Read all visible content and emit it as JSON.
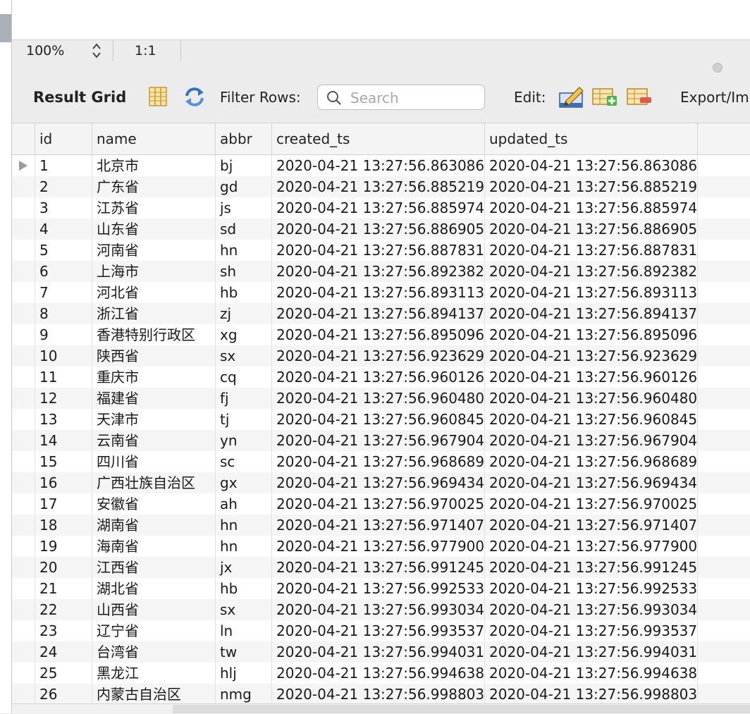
{
  "zoombar": {
    "zoom": "100%",
    "ratio": "1:1"
  },
  "toolbar": {
    "result_grid": "Result Grid",
    "filter_rows": "Filter Rows:",
    "search_placeholder": "Search",
    "edit": "Edit:",
    "export": "Export/Im",
    "icons": [
      "form-view-icon",
      "refresh-icon",
      "edit-row-icon",
      "insert-row-icon",
      "delete-row-icon"
    ]
  },
  "table": {
    "columns": [
      "id",
      "name",
      "abbr",
      "created_ts",
      "updated_ts"
    ],
    "rows": [
      [
        "1",
        "北京市",
        "bj",
        "2020-04-21 13:27:56.863086",
        "2020-04-21 13:27:56.863086"
      ],
      [
        "2",
        "广东省",
        "gd",
        "2020-04-21 13:27:56.885219",
        "2020-04-21 13:27:56.885219"
      ],
      [
        "3",
        "江苏省",
        "js",
        "2020-04-21 13:27:56.885974",
        "2020-04-21 13:27:56.885974"
      ],
      [
        "4",
        "山东省",
        "sd",
        "2020-04-21 13:27:56.886905",
        "2020-04-21 13:27:56.886905"
      ],
      [
        "5",
        "河南省",
        "hn",
        "2020-04-21 13:27:56.887831",
        "2020-04-21 13:27:56.887831"
      ],
      [
        "6",
        "上海市",
        "sh",
        "2020-04-21 13:27:56.892382",
        "2020-04-21 13:27:56.892382"
      ],
      [
        "7",
        "河北省",
        "hb",
        "2020-04-21 13:27:56.893113",
        "2020-04-21 13:27:56.893113"
      ],
      [
        "8",
        "浙江省",
        "zj",
        "2020-04-21 13:27:56.894137",
        "2020-04-21 13:27:56.894137"
      ],
      [
        "9",
        "香港特别行政区",
        "xg",
        "2020-04-21 13:27:56.895096",
        "2020-04-21 13:27:56.895096"
      ],
      [
        "10",
        "陕西省",
        "sx",
        "2020-04-21 13:27:56.923629",
        "2020-04-21 13:27:56.923629"
      ],
      [
        "11",
        "重庆市",
        "cq",
        "2020-04-21 13:27:56.960126",
        "2020-04-21 13:27:56.960126"
      ],
      [
        "12",
        "福建省",
        "fj",
        "2020-04-21 13:27:56.960480",
        "2020-04-21 13:27:56.960480"
      ],
      [
        "13",
        "天津市",
        "tj",
        "2020-04-21 13:27:56.960845",
        "2020-04-21 13:27:56.960845"
      ],
      [
        "14",
        "云南省",
        "yn",
        "2020-04-21 13:27:56.967904",
        "2020-04-21 13:27:56.967904"
      ],
      [
        "15",
        "四川省",
        "sc",
        "2020-04-21 13:27:56.968689",
        "2020-04-21 13:27:56.968689"
      ],
      [
        "16",
        "广西壮族自治区",
        "gx",
        "2020-04-21 13:27:56.969434",
        "2020-04-21 13:27:56.969434"
      ],
      [
        "17",
        "安徽省",
        "ah",
        "2020-04-21 13:27:56.970025",
        "2020-04-21 13:27:56.970025"
      ],
      [
        "18",
        "湖南省",
        "hn",
        "2020-04-21 13:27:56.971407",
        "2020-04-21 13:27:56.971407"
      ],
      [
        "19",
        "海南省",
        "hn",
        "2020-04-21 13:27:56.977900",
        "2020-04-21 13:27:56.977900"
      ],
      [
        "20",
        "江西省",
        "jx",
        "2020-04-21 13:27:56.991245",
        "2020-04-21 13:27:56.991245"
      ],
      [
        "21",
        "湖北省",
        "hb",
        "2020-04-21 13:27:56.992533",
        "2020-04-21 13:27:56.992533"
      ],
      [
        "22",
        "山西省",
        "sx",
        "2020-04-21 13:27:56.993034",
        "2020-04-21 13:27:56.993034"
      ],
      [
        "23",
        "辽宁省",
        "ln",
        "2020-04-21 13:27:56.993537",
        "2020-04-21 13:27:56.993537"
      ],
      [
        "24",
        "台湾省",
        "tw",
        "2020-04-21 13:27:56.994031",
        "2020-04-21 13:27:56.994031"
      ],
      [
        "25",
        "黑龙江",
        "hlj",
        "2020-04-21 13:27:56.994638",
        "2020-04-21 13:27:56.994638"
      ],
      [
        "26",
        "内蒙古自治区",
        "nmg",
        "2020-04-21 13:27:56.998803",
        "2020-04-21 13:27:56.998803"
      ]
    ]
  }
}
